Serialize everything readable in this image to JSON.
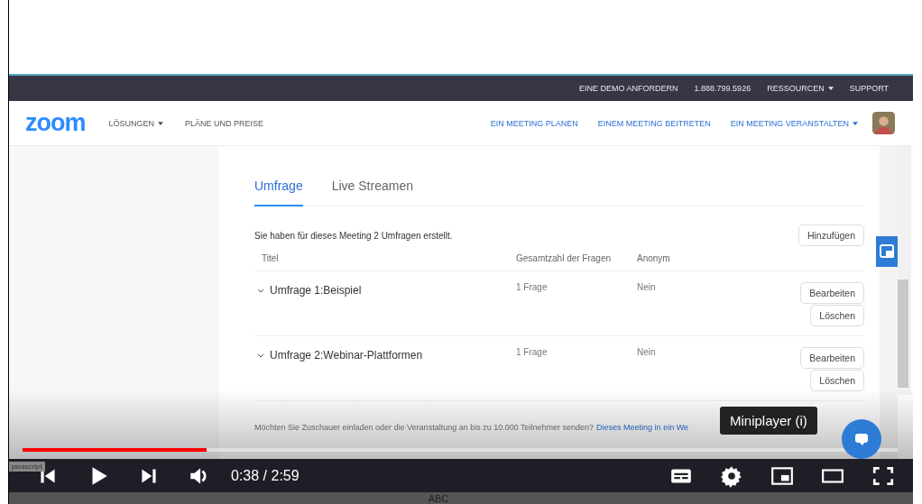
{
  "site": {
    "top_bar": [
      {
        "label": "EINE DEMO ANFORDERN",
        "kind": "link"
      },
      {
        "label": "1.888.799.5926",
        "kind": "link"
      },
      {
        "label": "RESSOURCEN",
        "kind": "dropdown"
      },
      {
        "label": "SUPPORT",
        "kind": "link"
      }
    ],
    "logo": "zoom",
    "nav_left": [
      {
        "label": "LÖSUNGEN",
        "kind": "dropdown"
      },
      {
        "label": "PLÄNE UND PREISE",
        "kind": "link"
      }
    ],
    "nav_right": [
      {
        "label": "EIN MEETING PLANEN",
        "kind": "link"
      },
      {
        "label": "EINEM MEETING BEITRETEN",
        "kind": "link"
      },
      {
        "label": "EIN MEETING VERANSTALTEN",
        "kind": "dropdown"
      }
    ],
    "tabs": [
      {
        "label": "Umfrage",
        "selected": true
      },
      {
        "label": "Live Streamen",
        "selected": false
      }
    ],
    "summary": "Sie haben für dieses Meeting 2 Umfragen erstellt.",
    "add_button": "Hinzufügen",
    "table": {
      "columns": [
        "Titel",
        "Gesamtzahl der Fragen",
        "Anonym"
      ],
      "rows": [
        {
          "title": "Umfrage 1:Beispiel",
          "questions": "1 Frage",
          "anonymous": "Nein",
          "buttons": [
            "Bearbeiten",
            "Löschen"
          ]
        },
        {
          "title": "Umfrage 2:Webinar-Plattformen",
          "questions": "1 Frage",
          "anonymous": "Nein",
          "buttons": [
            "Bearbeiten",
            "Löschen"
          ]
        }
      ]
    },
    "footer_note": "Möchten Sie Zuschauer einladen oder die Veranstaltung an bis zu 10.000 Teilnehmer senden?",
    "footer_link": "Dieses Meeting in ein We"
  },
  "player": {
    "playing": false,
    "progress": {
      "level": 0.21
    },
    "time": "0:38 / 2:59",
    "tooltip": "Miniplayer (i)",
    "overlay_tag": "javascript",
    "caption": "ABC"
  }
}
